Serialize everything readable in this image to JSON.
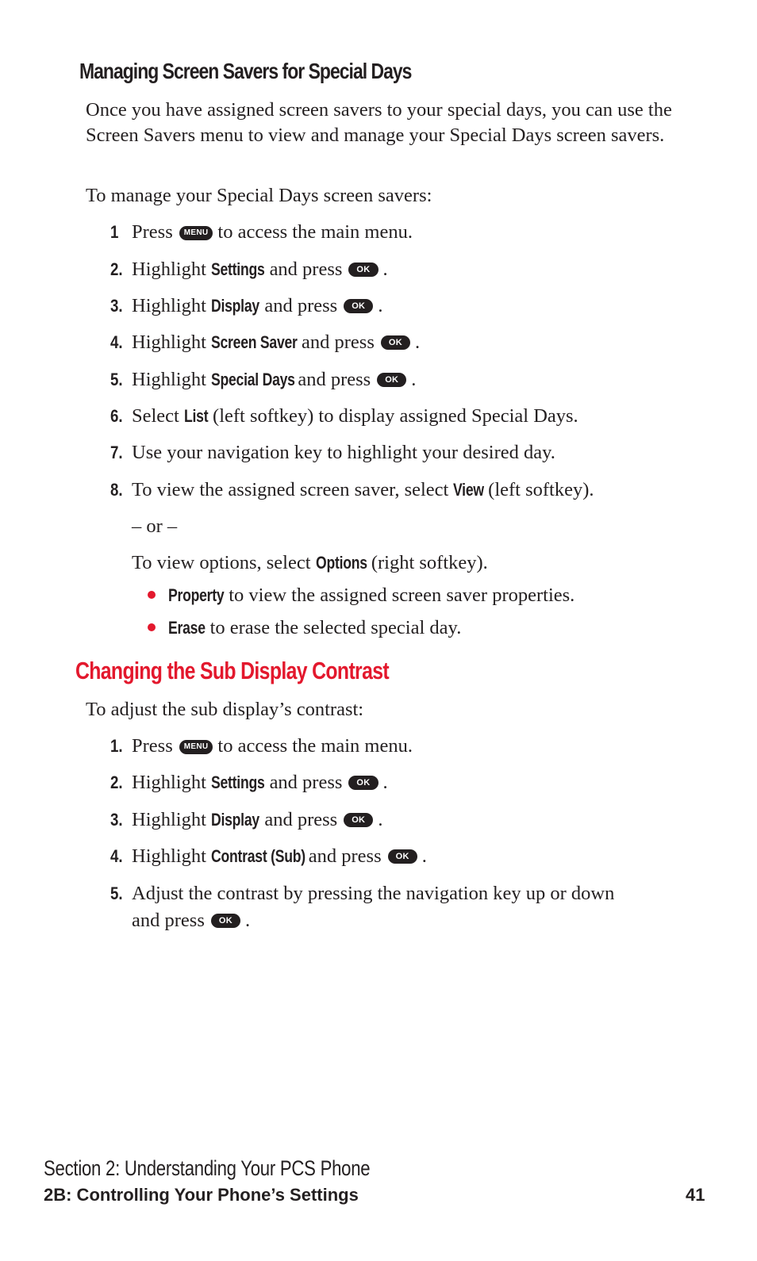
{
  "section1": {
    "heading": "Managing Screen Savers for Special Days",
    "intro": "Once you have assigned screen savers to your special days, you can use the Screen Savers menu to view and manage your Special Days screen savers.",
    "lead": "To manage your Special Days screen savers:",
    "steps": [
      {
        "num": "1",
        "pre": "Press",
        "key": "MENU",
        "post": "to access the main menu."
      },
      {
        "num": "2.",
        "pre": "Highlight",
        "bold": "Settings",
        "mid": "and press",
        "key": "OK",
        "post": "."
      },
      {
        "num": "3.",
        "pre": "Highlight",
        "bold": "Display",
        "mid": "and press",
        "key": "OK",
        "post": "."
      },
      {
        "num": "4.",
        "pre": "Highlight",
        "bold": "Screen Saver",
        "mid": "and press",
        "key": "OK",
        "post": "."
      },
      {
        "num": "5.",
        "pre": "Highlight",
        "bold": "Special Days",
        "mid": "and press",
        "key": "OK",
        "post": "."
      },
      {
        "num": "6.",
        "pre": "Select",
        "bold": "List",
        "post": "(left softkey) to display assigned Special Days."
      },
      {
        "num": "7.",
        "pre": "Use your navigation key to highlight your desired day."
      },
      {
        "num": "8.",
        "pre": "To view the assigned screen saver, select",
        "bold": "View",
        "post": "(left softkey)."
      }
    ],
    "or_text": "– or –",
    "options_pre": "To view options, select",
    "options_bold": "Options",
    "options_post": "(right softkey).",
    "bullets": [
      {
        "bold": "Property",
        "text": "to view the assigned screen saver properties."
      },
      {
        "bold": "Erase",
        "text": "to erase the selected special day."
      }
    ]
  },
  "section2": {
    "heading": "Changing the Sub Display Contrast",
    "lead": "To adjust the sub display’s contrast:",
    "steps": [
      {
        "num": "1.",
        "pre": "Press",
        "key": "MENU",
        "post": "to access the main menu."
      },
      {
        "num": "2.",
        "pre": "Highlight",
        "bold": "Settings",
        "mid": "and press",
        "key": "OK",
        "post": "."
      },
      {
        "num": "3.",
        "pre": "Highlight",
        "bold": "Display",
        "mid": "and press",
        "key": "OK",
        "post": "."
      },
      {
        "num": "4.",
        "pre": "Highlight",
        "bold": "Contrast (Sub)",
        "mid": "and press",
        "key": "OK",
        "post": "."
      },
      {
        "num": "5.",
        "line1": "Adjust the contrast by pressing the navigation key up or down",
        "line2_pre": "and press",
        "key": "OK",
        "post": "."
      }
    ]
  },
  "footer": {
    "section": "Section 2: Understanding Your PCS Phone",
    "chapter": "2B: Controlling Your Phone’s Settings",
    "page": "41"
  },
  "colors": {
    "accent": "#e3182d",
    "text": "#231f20"
  }
}
